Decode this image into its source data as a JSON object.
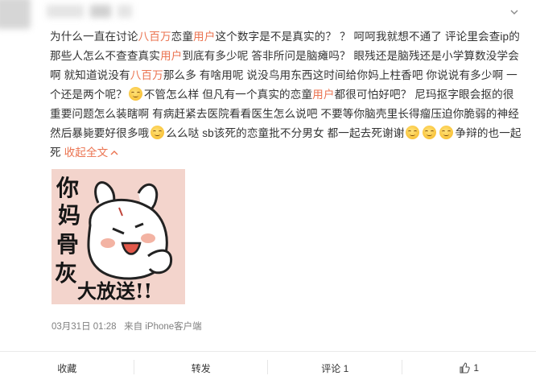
{
  "header": {
    "more_icon": "chevron-down-icon"
  },
  "post": {
    "segments": [
      {
        "t": "为什么一直在讨论"
      },
      {
        "t": "八百万",
        "c": "hl"
      },
      {
        "t": "恋童"
      },
      {
        "t": "用户",
        "c": "hl"
      },
      {
        "t": "这个数字是不是真实的？ ？ 呵呵我就想不通了 评论里会查ip的那些人怎么不查查真实"
      },
      {
        "t": "用户",
        "c": "hl"
      },
      {
        "t": "到底有多少呢 答非所问是脑瘫吗？ 眼残还是脑残还是小学算数没学会啊 就知道说没有"
      },
      {
        "t": "八百万",
        "c": "hl"
      },
      {
        "t": "那么多 有啥用呢 说没鸟用东西这时间给你妈上柱香吧 你说说有多少啊 一个还是两个呢？"
      },
      {
        "emoji": "smile"
      },
      {
        "t": "不管怎么样 但凡有一个真实的恋童"
      },
      {
        "t": "用户",
        "c": "hl"
      },
      {
        "t": "都很可怕好吧？ 尼玛抠字眼会抠的很 重要问题怎么装瞎啊 有病赶紧去医院看看医生怎么说吧 不要等你脑壳里长得瘤压迫你脆弱的神经 然后暴毙要好很多哦"
      },
      {
        "emoji": "smile"
      },
      {
        "t": "么么哒 sb该死的恋童批不分男女 都一起去死谢谢"
      },
      {
        "emoji": "smile"
      },
      {
        "emoji": "smile"
      },
      {
        "emoji": "smile"
      },
      {
        "t": "争辩的也一起死 "
      },
      {
        "t": "收起全文",
        "c": "expand"
      }
    ],
    "expand_icon": "chevron-up-icon"
  },
  "sticker": {
    "lines": [
      "你",
      "妈",
      "骨",
      "灰",
      "大放送!!"
    ]
  },
  "meta": {
    "date": "03月31日 01:28",
    "source": "来自 iPhone客户端"
  },
  "footer": {
    "favorite_label": "收藏",
    "repost_label": "转发",
    "comment_label": "评论 1",
    "like_count": "1",
    "like_icon": "thumbs-up-icon"
  }
}
